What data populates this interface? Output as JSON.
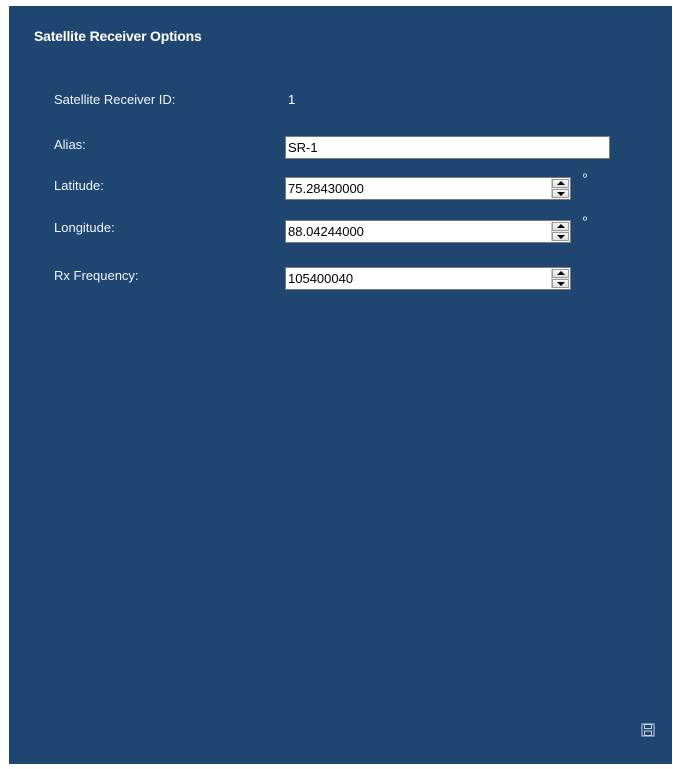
{
  "panel": {
    "title": "Satellite Receiver Options"
  },
  "fields": {
    "receiver_id": {
      "label": "Satellite Receiver ID:",
      "value": "1"
    },
    "alias": {
      "label": "Alias:",
      "value": "SR-1"
    },
    "latitude": {
      "label": "Latitude:",
      "value": "75.28430000",
      "unit": "º"
    },
    "longitude": {
      "label": "Longitude:",
      "value": "88.04244000",
      "unit": "º"
    },
    "rx_frequency": {
      "label": "Rx Frequency:",
      "value": "105400040"
    }
  },
  "icons": {
    "spinner_up": "up-arrow-icon",
    "spinner_down": "down-arrow-icon",
    "save": "save-icon"
  },
  "colors": {
    "panel_background": "#1f4571",
    "text": "#ffffff"
  }
}
